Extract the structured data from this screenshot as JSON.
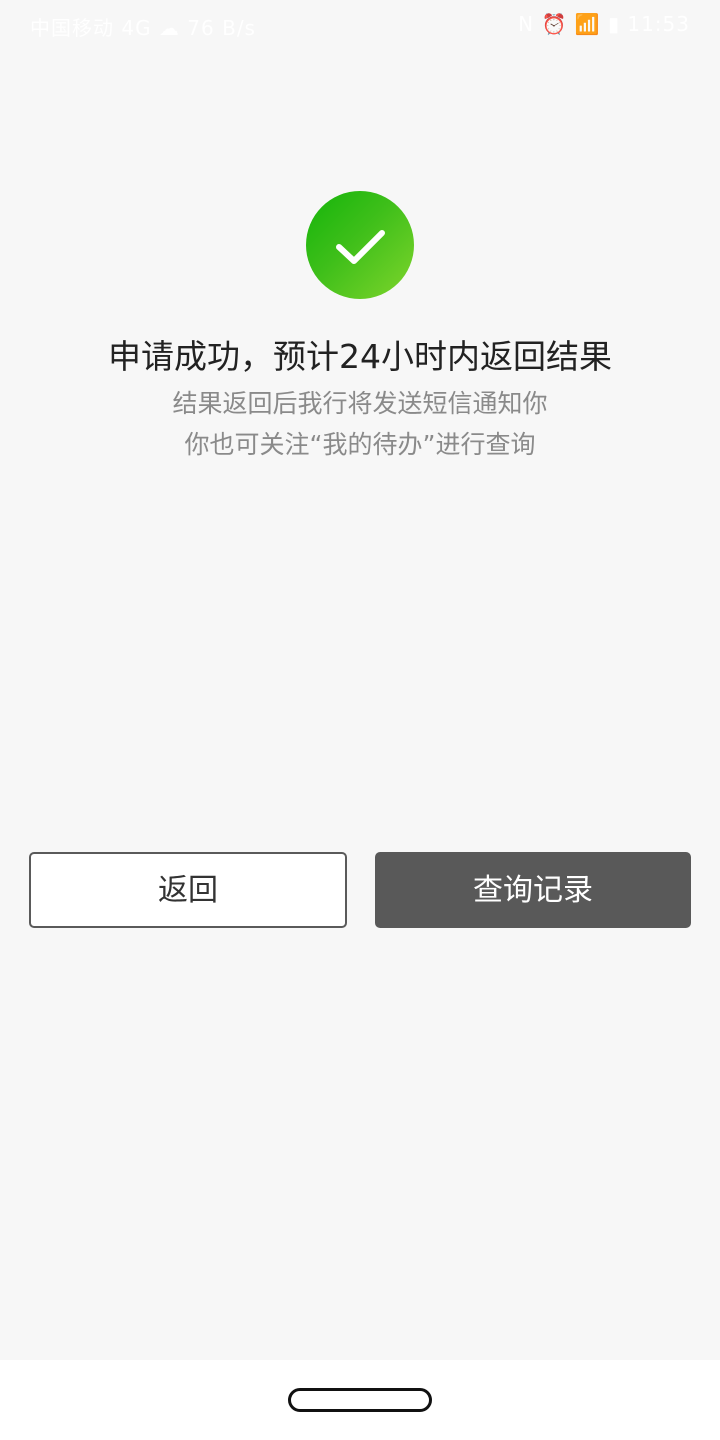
{
  "status_bar": {
    "left_text": "中国移动 4G  ☁  76 B/s",
    "right_text": "N ⏰ 📶 ▮ 11:53"
  },
  "result": {
    "icon": "checkmark-icon",
    "icon_color": "#3cbf1a",
    "title": "申请成功，预计24小时内返回结果",
    "subtitle_line1": "结果返回后我行将发送短信通知你",
    "subtitle_line2": "你也可关注“我的待办”进行查询"
  },
  "actions": {
    "back_label": "返回",
    "query_label": "查询记录"
  },
  "colors": {
    "background": "#f7f7f7",
    "primary_button": "#595959",
    "success": "#3cbf1a"
  }
}
